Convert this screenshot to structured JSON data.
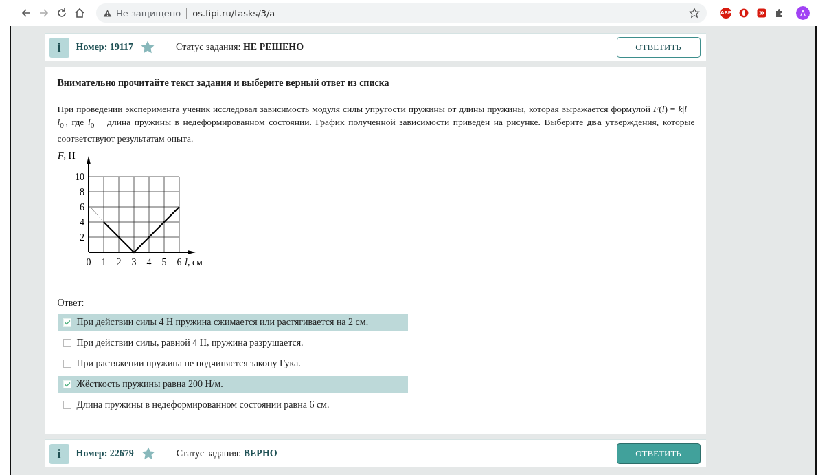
{
  "browser": {
    "security": "Не защищено",
    "url": "os.fipi.ru/tasks/3/a",
    "extension_label": "ABP",
    "avatar": "A"
  },
  "tasks": [
    {
      "info_badge": "i",
      "number_label": "Номер:",
      "number": "19117",
      "status_label": "Статус задания:",
      "status": "НЕ РЕШЕНО",
      "kind": "unsolved",
      "button": "ОТВЕТИТЬ"
    },
    {
      "info_badge": "i",
      "number_label": "Номер:",
      "number": "22679",
      "status_label": "Статус задания:",
      "status": "ВЕРНО",
      "kind": "correct",
      "button": "ОТВЕТИТЬ"
    }
  ],
  "question": {
    "instruction": "Внимательно прочитайте текст задания и выберите верный ответ из списка",
    "text": "При проведении эксперимента ученик исследовал зависимость модуля силы упругости пружины от длины пружины, которая выражается формулой *F*(*l*) = *k*|*l* − *l*$_{0}$|, где *l*$_{0}$ − длина пружины в недеформированном состоянии. График полученной зависимости приведён на рисунке. Выберите **два** утверждения, которые соответствуют результатам опыта.",
    "chart_data": {
      "type": "line",
      "ylabel": "*F*, Н",
      "xlabel": "*l*, см",
      "x": [
        1,
        2,
        3,
        4,
        5,
        6
      ],
      "series": [
        {
          "color": "#000000",
          "values": [
            4,
            2,
            0,
            2,
            4,
            6
          ]
        }
      ],
      "xlim": [
        0,
        6
      ],
      "ylim": [
        0,
        10
      ],
      "xticks": [
        0,
        1,
        2,
        3,
        4,
        5,
        6
      ],
      "yticks": [
        2,
        4,
        6,
        8,
        10
      ],
      "grid": true
    },
    "answer_label": "Ответ:",
    "options": [
      {
        "text": "При действии силы 4 Н пружина сжимается или растягивается на 2 см.",
        "checked": true
      },
      {
        "text": "При действии силы, равной 4 Н, пружина разрушается.",
        "checked": false
      },
      {
        "text": "При растяжении пружина не подчиняется закону Гука.",
        "checked": false
      },
      {
        "text": "Жёсткость пружины равна 200 Н/м.",
        "checked": true
      },
      {
        "text": "Длина пружины в недеформированном состоянии равна 6 см.",
        "checked": false
      }
    ]
  }
}
